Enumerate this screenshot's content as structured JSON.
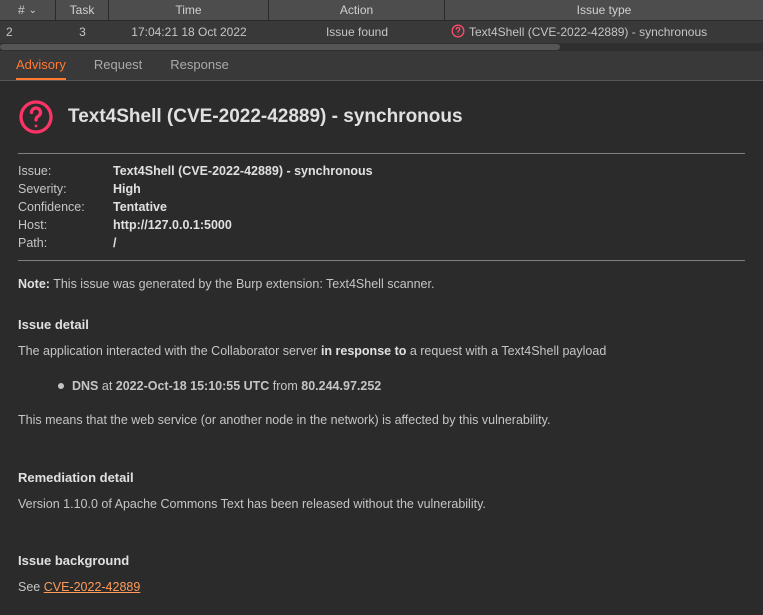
{
  "columns": {
    "num": "#",
    "task": "Task",
    "time": "Time",
    "action": "Action",
    "issue": "Issue type"
  },
  "row": {
    "num": "2",
    "task": "3",
    "time": "17:04:21 18 Oct 2022",
    "action": "Issue found",
    "issue": "Text4Shell (CVE-2022-42889) - synchronous"
  },
  "tabs": {
    "advisory": "Advisory",
    "request": "Request",
    "response": "Response"
  },
  "advisory": {
    "title": "Text4Shell (CVE-2022-42889) - synchronous",
    "meta": {
      "issue_label": "Issue:",
      "issue": "Text4Shell (CVE-2022-42889) - synchronous",
      "severity_label": "Severity:",
      "severity": "High",
      "confidence_label": "Confidence:",
      "confidence": "Tentative",
      "host_label": "Host:",
      "host": "http://127.0.0.1:5000",
      "path_label": "Path:",
      "path": "/"
    },
    "note_label": "Note:",
    "note_text": "This issue was generated by the Burp extension: Text4Shell scanner.",
    "detail": {
      "heading": "Issue detail",
      "line1_pre": "The application interacted with the Collaborator server ",
      "line1_bold": "in response to",
      "line1_post": " a request with a Text4Shell payload",
      "bullet_type": "DNS",
      "bullet_at": " at ",
      "bullet_time": "2022-Oct-18 15:10:55 UTC",
      "bullet_from": " from ",
      "bullet_ip": "80.244.97.252",
      "line2": "This means that the web service (or another node in the network) is affected by this vulnerability."
    },
    "remediation": {
      "heading": "Remediation detail",
      "text": "Version 1.10.0 of Apache Commons Text has been released without the vulnerability."
    },
    "background": {
      "heading": "Issue background",
      "see": "See ",
      "link": "CVE-2022-42889"
    }
  }
}
